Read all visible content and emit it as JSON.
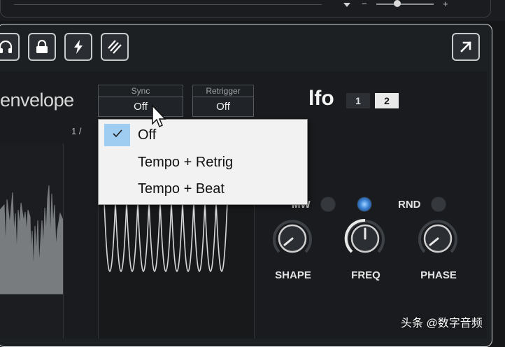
{
  "toolbar": {
    "buttons": [
      {
        "icon": "headphones-icon"
      },
      {
        "icon": "lock-icon"
      },
      {
        "icon": "lightning-icon"
      },
      {
        "icon": "hash-slash-icon"
      }
    ],
    "expand_icon": "arrow-up-right-icon"
  },
  "envelope": {
    "title": "envelope",
    "number": "1 /"
  },
  "sync": {
    "label": "Sync",
    "value": "Off",
    "options": [
      "Off",
      "Tempo + Retrig",
      "Tempo + Beat"
    ],
    "selected_index": 0
  },
  "retrigger": {
    "label": "Retrigger",
    "value": "Off"
  },
  "lfo": {
    "title": "lfo",
    "tabs": [
      "1",
      "2"
    ],
    "active_tab": "2",
    "mod_sources": [
      {
        "label": "MW",
        "active": false
      },
      {
        "label": "",
        "active": true
      },
      {
        "label": "RND",
        "active": false
      }
    ],
    "knobs": [
      {
        "label": "SHAPE"
      },
      {
        "label": "FREQ"
      },
      {
        "label": "PHASE"
      }
    ]
  },
  "watermark": "头条 @数字音频",
  "colors": {
    "accent_blue": "#3b82d6",
    "selection": "#9fcdf2",
    "panel_bg": "#1d2023"
  }
}
